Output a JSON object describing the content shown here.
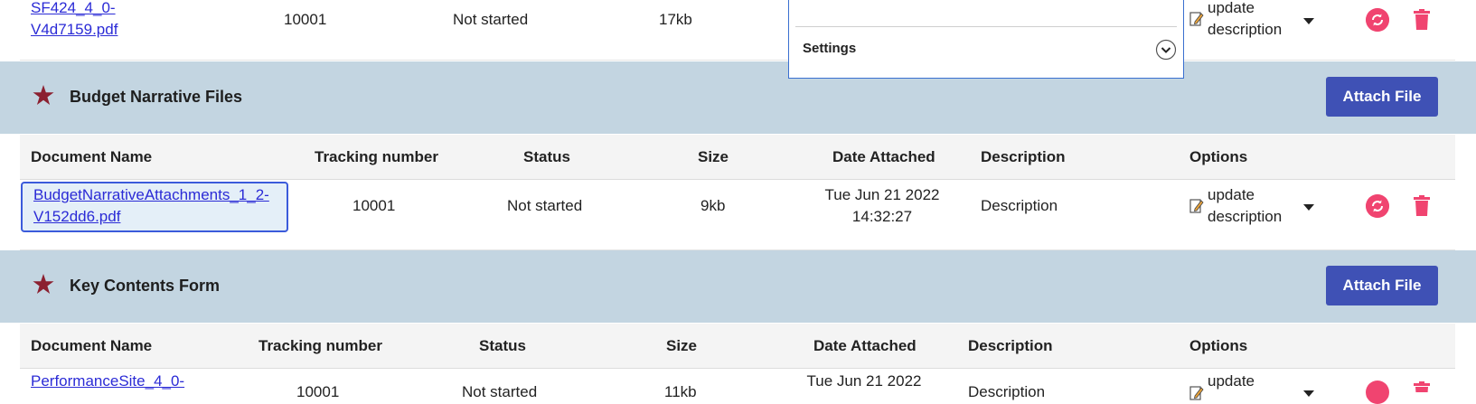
{
  "row0": {
    "doc_name": "SF424_4_0-V4d7159.pdf",
    "doc_line1": "SF424_4_0-",
    "doc_line2": "V4d7159.pdf",
    "tracking": "10001",
    "status": "Not started",
    "size": "17kb",
    "option_line1": "update",
    "option_line2": "description"
  },
  "dropdown": {
    "settings_label": "Settings"
  },
  "section1": {
    "title": "Budget Narrative Files",
    "attach_label": "Attach File",
    "headers": {
      "doc": "Document Name",
      "tracking": "Tracking number",
      "status": "Status",
      "size": "Size",
      "date": "Date Attached",
      "desc": "Description",
      "options": "Options"
    },
    "row": {
      "doc_line1": "BudgetNarrativeAttachments_1_2-",
      "doc_line2": "V152dd6.pdf",
      "tracking": "10001",
      "status": "Not started",
      "size": "9kb",
      "date_line1": "Tue Jun 21 2022",
      "date_line2": "14:32:27",
      "description": "Description",
      "option_line1": "update",
      "option_line2": "description"
    }
  },
  "section2": {
    "title": "Key Contents Form",
    "attach_label": "Attach File",
    "headers": {
      "doc": "Document Name",
      "tracking": "Tracking number",
      "status": "Status",
      "size": "Size",
      "date": "Date Attached",
      "desc": "Description",
      "options": "Options"
    },
    "row": {
      "doc_line1": "PerformanceSite_4_0-",
      "tracking": "10001",
      "status": "Not started",
      "size": "11kb",
      "date_line1": "Tue Jun 21 2022",
      "description": "Description",
      "option_line1": "update"
    }
  },
  "colors": {
    "band": "#c3d5e1",
    "button": "#3f51b5",
    "star": "#8b2030",
    "action": "#f04470"
  }
}
